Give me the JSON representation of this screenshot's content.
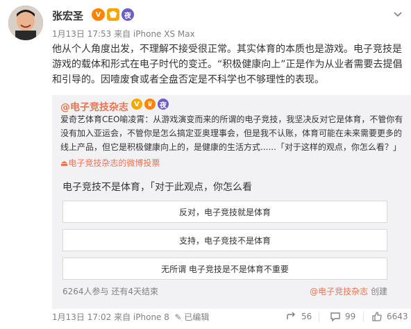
{
  "post": {
    "author": "张宏圣",
    "meta": "1月13日 17:53 来自 iPhone XS Max",
    "content": "他从个人角度出发，不理解不接受很正常。其实体育的本质也是游戏。电子竞技是游戏的载体和形式在电子时代的变迁。“积极健康向上”正是作为从业者需要去提倡和引导的。因噎废食或者全盘否定是不科学也不够理性的表现。"
  },
  "repost": {
    "author": "@电子竞技杂志",
    "text": "爱奇艺体育CEO喻凌霄：从游戏演变而来的所谓的电子竞技，我坚决反对它是体育，不管你有没有加入亚运会，不管你是怎么搞定亚奥理事会，但是我不认账，体育可能在未来需要更多的线上产品，但它是积极健康向上的，是健康的生活方式......「对于这样的观点，你怎么看？」",
    "vote_link": "电子竞技杂志的微博投票",
    "vote": {
      "title": "电子竞技不是体育，「对于此观点，你怎么看",
      "options": [
        "反对，电子竞技就是体育",
        "支持，电子竞技不是体育",
        "无所谓 电子竞技是不是体育不重要"
      ],
      "stats": "6264人参与  还有4天结束",
      "creator_link": "@电子竞技杂志",
      "creator_suffix": " 创建"
    },
    "footer": {
      "meta": "1月13日 17:02 来自 iPhone 8",
      "edited": "已编辑",
      "forward_count": "56",
      "comment_count": "99",
      "like_count": "6643"
    }
  },
  "icons": {
    "dropdown": "chevron-down-icon",
    "forward": "forward-icon",
    "comment": "comment-icon",
    "like": "thumbs-up-icon",
    "edit": "edit-icon"
  },
  "colors": {
    "accent": "#eb7350",
    "repost_bg": "#f2f2f5",
    "meta_gray": "#808080"
  }
}
